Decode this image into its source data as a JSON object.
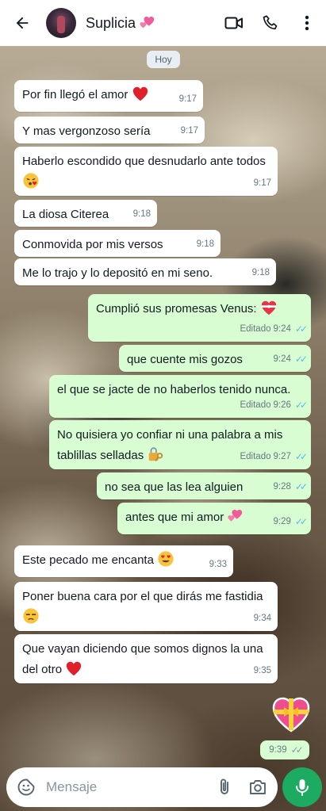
{
  "header": {
    "contact_name": "Suplicia",
    "icons": [
      "back-arrow-icon",
      "video-call-icon",
      "phone-icon",
      "more-options-icon"
    ]
  },
  "date_chip": "Hoy",
  "messages": [
    {
      "dir": "in",
      "text": "Por fin llegó el amor",
      "emoji": "red-heart",
      "time": "9:17"
    },
    {
      "dir": "in",
      "text": "Y mas vergonzoso sería",
      "time": "9:17"
    },
    {
      "dir": "in",
      "text": "Haberlo escondido que desnudarlo ante todos",
      "emoji": "face-blowing-kiss",
      "time": "9:17"
    },
    {
      "dir": "in",
      "text": "La diosa Citerea",
      "time": "9:18"
    },
    {
      "dir": "in",
      "text": "Conmovida por mis versos",
      "time": "9:18"
    },
    {
      "dir": "in",
      "text": "Me lo trajo y lo depositó en mi seno.",
      "time": "9:18"
    },
    {
      "dir": "out",
      "text": "Cumplió sus promesas Venus:",
      "emoji": "heart-with-ribbon",
      "time": "9:24",
      "edited": "Editado"
    },
    {
      "dir": "out",
      "text": "que cuente mis gozos",
      "time": "9:24"
    },
    {
      "dir": "out",
      "text": "el que se jacte de no haberlos tenido nunca.",
      "time": "9:26",
      "edited": "Editado"
    },
    {
      "dir": "out",
      "text": "No quisiera yo confiar ni una palabra a mis tablillas selladas",
      "emoji": "locked-with-key",
      "time": "9:27",
      "edited": "Editado"
    },
    {
      "dir": "out",
      "text": "no sea que las lea alguien",
      "time": "9:28"
    },
    {
      "dir": "out",
      "text": "antes que mi amor",
      "emoji": "revolving-hearts",
      "time": "9:29"
    },
    {
      "dir": "in",
      "text": "Este pecado me encanta",
      "emoji": "heart-eyes",
      "time": "9:33"
    },
    {
      "dir": "in",
      "text": "Poner buena cara por el que dirás me fastidia",
      "emoji": "unamused-face",
      "time": "9:34"
    },
    {
      "dir": "in",
      "text": "Que vayan diciendo que somos dignos la una del otro",
      "emoji": "red-heart",
      "time": "9:35"
    }
  ],
  "sticker": {
    "icon": "heart-with-ribbon-sticker",
    "time": "9:39"
  },
  "composer": {
    "placeholder": "Mensaje",
    "icons": [
      "sticker-icon",
      "attach-icon",
      "camera-icon",
      "mic-icon"
    ]
  },
  "colors": {
    "incoming_bubble": "#ffffff",
    "outgoing_bubble": "#d9fdd3",
    "read_ticks": "#53bdeb",
    "mic_button": "#1daa61"
  }
}
